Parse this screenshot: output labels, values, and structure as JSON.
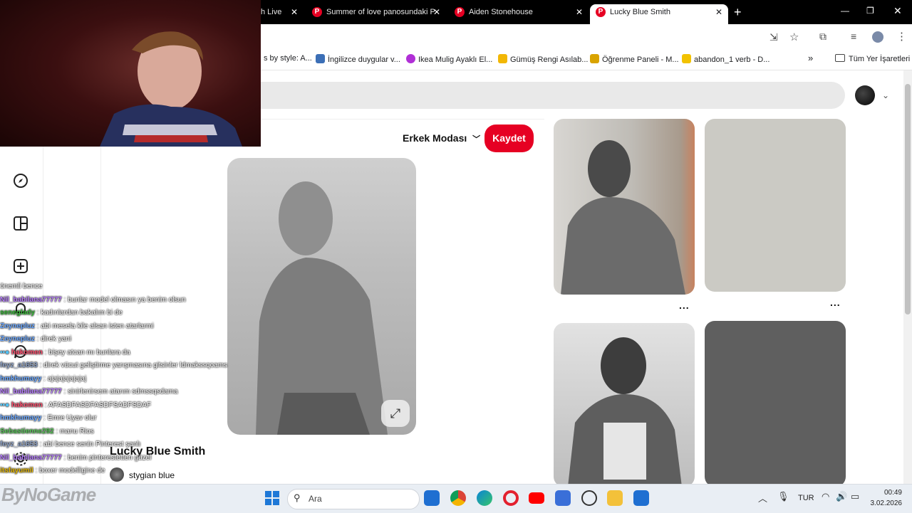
{
  "browser": {
    "tabs": [
      {
        "title": "h Live"
      },
      {
        "title": "Summer of love panosundaki P"
      },
      {
        "title": "Aiden Stonehouse"
      },
      {
        "title": "Lucky Blue Smith"
      }
    ],
    "new_tab": "+",
    "bookmarks": [
      {
        "label": "s by style: A...",
        "color": "#ffffff"
      },
      {
        "label": "İngilizce duygular v...",
        "color": "#3c6fb6"
      },
      {
        "label": "Ikea Mulig Ayaklı El...",
        "color": "#b02fd6"
      },
      {
        "label": "Gümüş Rengi Asılab...",
        "color": "#f2b705"
      },
      {
        "label": "Öğrenme Paneli - M...",
        "color": "#d9a300"
      },
      {
        "label": "abandon_1 verb - D...",
        "color": "#f2c200"
      }
    ],
    "bookmarks_more": "»",
    "all_bookmarks": "Tüm Yer İşaretleri"
  },
  "pin": {
    "board_selector": "Erkek Modası",
    "save_label": "Kaydet",
    "title": "Lucky Blue Smith",
    "creator": "stygian blue"
  },
  "grid": {
    "more": "..."
  },
  "chat": [
    {
      "user": "",
      "message": "önemli bence",
      "color": "#ffffff"
    },
    {
      "user": "Nil_babilana77777",
      "message": ": bunlar model olmasın ya benim olsun",
      "color": "#b77cff"
    },
    {
      "user": "seneglady",
      "message": ": kadınlardan bakalım bi de",
      "color": "#3dbf3d"
    },
    {
      "user": "Zeynepluz",
      "message": ": abi mesela kile alsan isten atarlarmi",
      "color": "#6aa7ff"
    },
    {
      "user": "Zeynepluz",
      "message": ": direk yani",
      "color": "#6aa7ff"
    },
    {
      "user": "hakomen",
      "message": ": bişey atcan mı bunlara da",
      "color": "#ff4d6d"
    },
    {
      "user": "feyz_a1653",
      "message": ": direk vücut geliştirme yarışmasına gitsinler ldmakssqoams",
      "color": "#8fa3c7"
    },
    {
      "user": "hmkhumayy",
      "message": ": ajajajajajajaj",
      "color": "#6aa7ff"
    },
    {
      "user": "Nil_babilana77777",
      "message": ": sinirlenirsem atarım sdmssqsdama",
      "color": "#b77cff"
    },
    {
      "user": "hakomen",
      "message": ": AFASDFASDFASDFSADFSDAF",
      "color": "#ff4d6d"
    },
    {
      "user": "hmkhumayy",
      "message": ": Emre Uyav olur",
      "color": "#6aa7ff"
    },
    {
      "user": "Sebastienne292",
      "message": ": manu Rios",
      "color": "#5ac85a"
    },
    {
      "user": "feyz_a1653",
      "message": ": abi bence senin Pinterest şanlı",
      "color": "#8fa3c7"
    },
    {
      "user": "Nil_babilana77777",
      "message": ": benim pinterestetten güzel",
      "color": "#b77cff"
    },
    {
      "user": "itsfayumil",
      "message": ": boxer modelligine de",
      "color": "#e6b800"
    }
  ],
  "watermark": "ByNoGame",
  "taskbar": {
    "search_placeholder": "Ara",
    "lang": "TUR",
    "time": "00:49",
    "date": "3.02.2026"
  }
}
